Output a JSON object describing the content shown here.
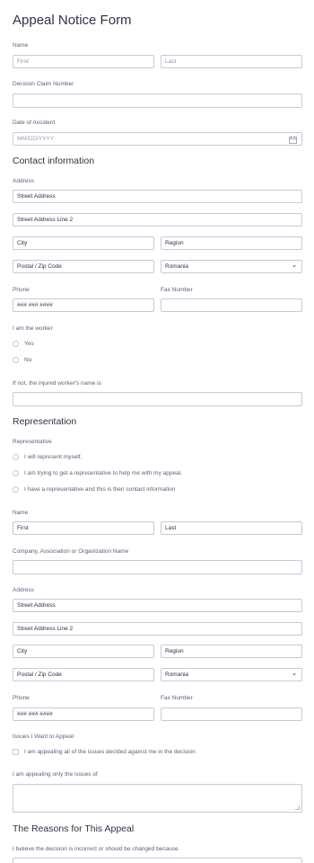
{
  "form": {
    "title": "Appeal Notice Form",
    "name": {
      "label": "Name",
      "first": "First",
      "last": "Last"
    },
    "decision_claim": {
      "label": "Decision Claim Number",
      "value": ""
    },
    "date_of_accident": {
      "label": "Date of Accident",
      "placeholder": "MM/DD/YYYY"
    },
    "contact_info": {
      "heading": "Contact information",
      "address_label": "Address",
      "street": "Street Address",
      "street2": "Street Address Line 2",
      "city": "City",
      "region": "Region",
      "postal": "Postal / Zip Code",
      "country": "Romania",
      "phone_label": "Phone",
      "phone_placeholder": "### ### ####",
      "fax_label": "Fax Number",
      "worker_label": "I am the worker",
      "worker_options": [
        "Yes",
        "No"
      ],
      "injured_name_label": "If not, the injured worker's name is"
    },
    "representation": {
      "heading": "Representation",
      "representative_label": "Representative",
      "options": [
        "I will represent myself.",
        "I am trying to get a representative to help me with my appeal.",
        "I have a representative and this is their contact information"
      ],
      "name_label": "Name",
      "first": "First",
      "last": "Last",
      "company_label": "Company, Association or Organization Name",
      "address_label": "Address",
      "street": "Street Address",
      "street2": "Street Address Line 2",
      "city": "City",
      "region": "Region",
      "postal": "Postal / Zip Code",
      "country": "Romania",
      "phone_label": "Phone",
      "phone_placeholder": "### ### ####",
      "fax_label": "Fax Number"
    },
    "issues": {
      "label": "Issues I Want to Appeal",
      "checkbox": "I am appealing all of the issues decided against me in the decision",
      "only_label": "I am appealing only the issues of"
    },
    "reasons": {
      "heading": "The Reasons for This Appeal",
      "label": "I believe the decision is incorrect or should be changed because"
    }
  }
}
